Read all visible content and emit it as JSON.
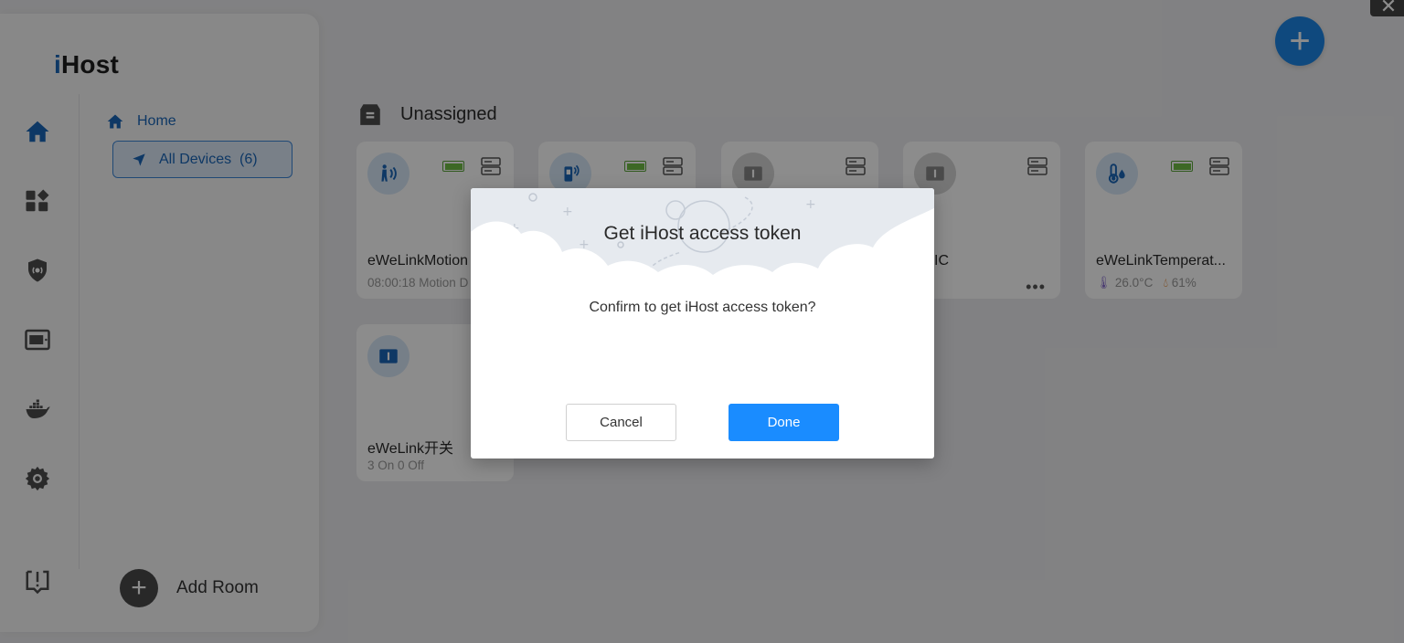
{
  "app": {
    "logo_prefix": "i",
    "logo_rest": "Host"
  },
  "sidebar": {
    "rail": [
      {
        "icon": "home-icon",
        "active": true
      },
      {
        "icon": "dashboard-icon"
      },
      {
        "icon": "security-shield-icon"
      },
      {
        "icon": "hub-device-icon"
      },
      {
        "icon": "docker-icon"
      },
      {
        "icon": "settings-gear-icon"
      },
      {
        "icon": "feedback-icon"
      }
    ],
    "home_label": "Home",
    "all_devices_label": "All Devices  (6)",
    "add_room_label": "Add Room"
  },
  "main": {
    "section_title": "Unassigned",
    "devices": [
      {
        "name": "eWeLinkMotion",
        "sub": "08:00:18 Motion D",
        "icon": "motion-sensor-icon",
        "battery": true,
        "online": true
      },
      {
        "name": "",
        "sub": "",
        "icon": "door-sensor-icon",
        "battery": true,
        "online": true
      },
      {
        "name": "",
        "sub": "",
        "icon": "switch-icon",
        "battery": false,
        "online": false
      },
      {
        "name": "IC",
        "sub": "",
        "icon": "switch-icon",
        "battery": false,
        "online": false,
        "menu": "•••"
      },
      {
        "name": "eWeLinkTemperat...",
        "sub_temp": "26.0°C",
        "sub_hum": "61%",
        "icon": "thermometer-icon",
        "battery": true,
        "online": true
      },
      {
        "name": "eWeLink开关",
        "sub": "3 On 0 Off",
        "icon": "switch-icon",
        "battery": false,
        "online": true
      }
    ]
  },
  "dialog": {
    "title": "Get iHost access token",
    "message": "Confirm to get iHost access token?",
    "cancel_label": "Cancel",
    "done_label": "Done"
  },
  "colors": {
    "accent": "#1a8cff",
    "brand": "#1a66b8",
    "battery": "#6fbe44"
  }
}
